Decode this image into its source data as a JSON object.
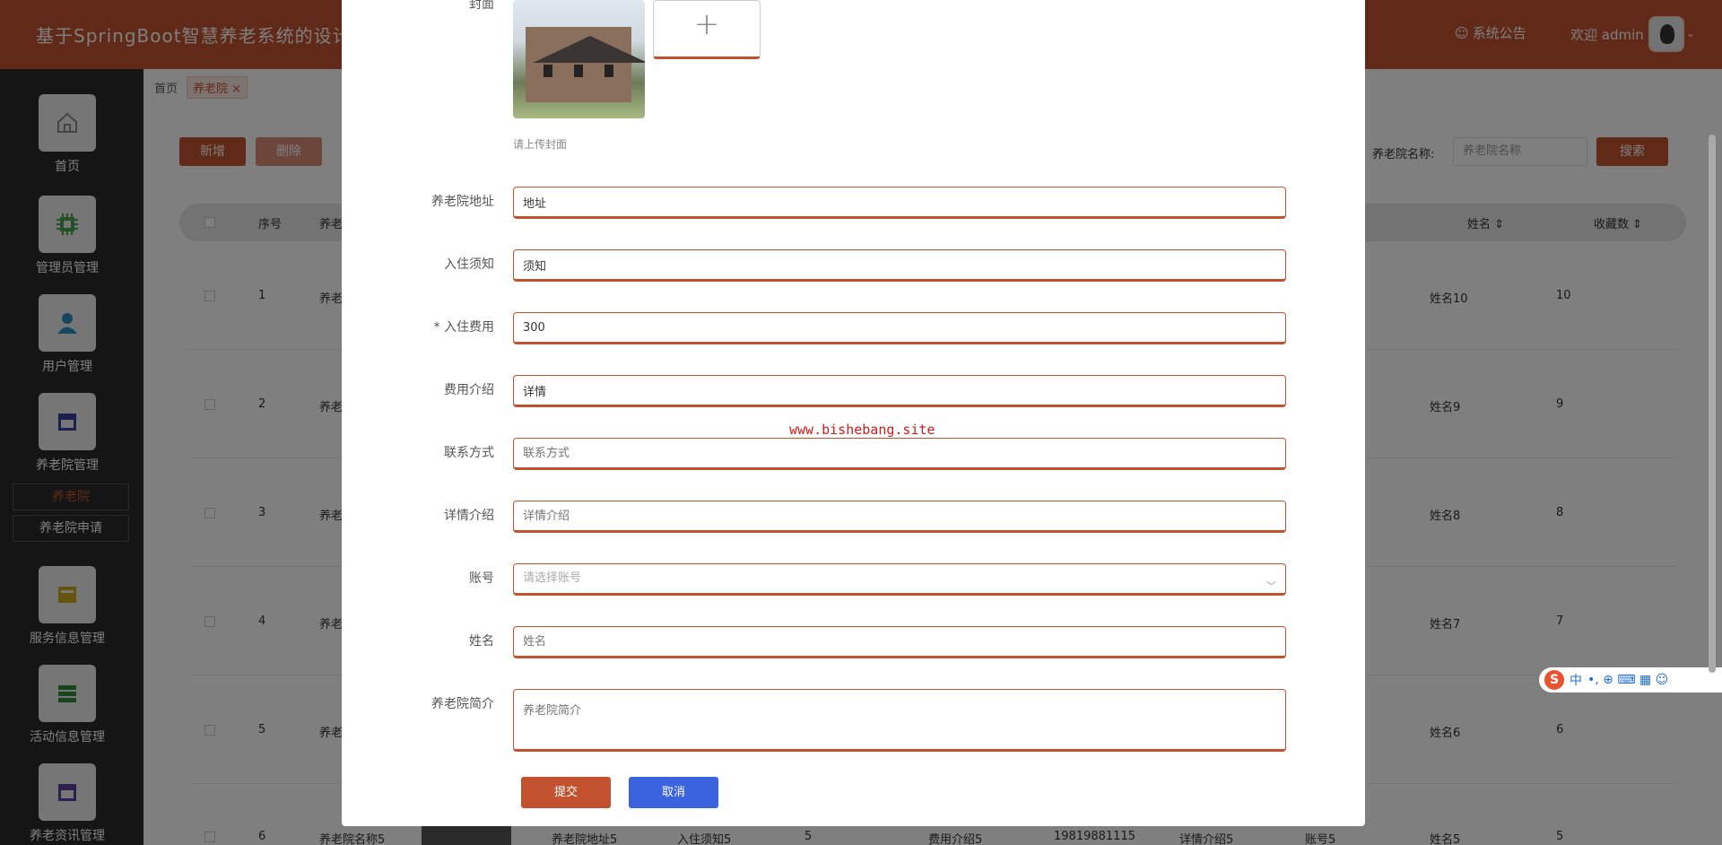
{
  "header": {
    "title": "基于SpringBoot智慧养老系统的设计",
    "notice": "系统公告",
    "welcome": "欢迎 admin",
    "caret": "⌄"
  },
  "sidebar": {
    "items": [
      {
        "label": "首页",
        "icon": "home-icon"
      },
      {
        "label": "管理员管理",
        "icon": "chip-icon"
      },
      {
        "label": "用户管理",
        "icon": "user-icon"
      },
      {
        "label": "养老院管理",
        "icon": "store-icon"
      },
      {
        "label": "服务信息管理",
        "icon": "card-icon"
      },
      {
        "label": "活动信息管理",
        "icon": "list-icon"
      },
      {
        "label": "养老资讯管理",
        "icon": "store-icon"
      }
    ],
    "sub_items": [
      "养老院",
      "养老院申请"
    ]
  },
  "breadcrumb": {
    "home": "首页",
    "tag": "养老院",
    "close": "×"
  },
  "toolbar": {
    "add_label": "新增",
    "delete_label": "删除",
    "search_label": "养老院名称:",
    "search_placeholder": "养老院名称",
    "search_button": "搜索"
  },
  "table": {
    "headers": {
      "seq": "序号",
      "name": "养老",
      "person": "姓名 ⇕",
      "fav": "收藏数 ⇕"
    },
    "rows": [
      {
        "seq": "1",
        "name": "养老",
        "person": "姓名10",
        "fav": "10"
      },
      {
        "seq": "2",
        "name": "养老",
        "person": "姓名9",
        "fav": "9"
      },
      {
        "seq": "3",
        "name": "养老",
        "person": "姓名8",
        "fav": "8"
      },
      {
        "seq": "4",
        "name": "养老",
        "person": "姓名7",
        "fav": "7"
      },
      {
        "seq": "5",
        "name": "养老",
        "person": "姓名6",
        "fav": "6"
      }
    ],
    "last_row": [
      "6",
      "养老院名称5",
      "养老院地址5",
      "入住须知5",
      "5",
      "费用介绍5",
      "19819881115",
      "详情介绍5",
      "账号5",
      "姓名5",
      "5"
    ]
  },
  "form": {
    "cover_label": "封面",
    "upload_plus": "+",
    "cover_hint": "请上传封面",
    "address": {
      "label": "养老院地址",
      "value": "地址"
    },
    "notice": {
      "label": "入住须知",
      "value": "须知"
    },
    "fee": {
      "label": "* 入住费用",
      "value": "300"
    },
    "fee_intro": {
      "label": "费用介绍",
      "value": "详情"
    },
    "contact": {
      "label": "联系方式",
      "placeholder": "联系方式"
    },
    "detail": {
      "label": "详情介绍",
      "placeholder": "详情介绍"
    },
    "account": {
      "label": "账号",
      "placeholder": "请选择账号"
    },
    "name": {
      "label": "姓名",
      "placeholder": "姓名"
    },
    "intro": {
      "label": "养老院简介",
      "placeholder": "养老院简介"
    },
    "submit_label": "提交",
    "cancel_label": "取消"
  },
  "watermark": "www.bishebang.site",
  "ime": {
    "logo": "S",
    "mode": "中",
    "extra": "•, ⊕ ⌨ ▦ ☺"
  },
  "colors": {
    "brand": "#c2522f",
    "cancel": "#3b63e0",
    "sidebar": "#2b2b2b"
  }
}
